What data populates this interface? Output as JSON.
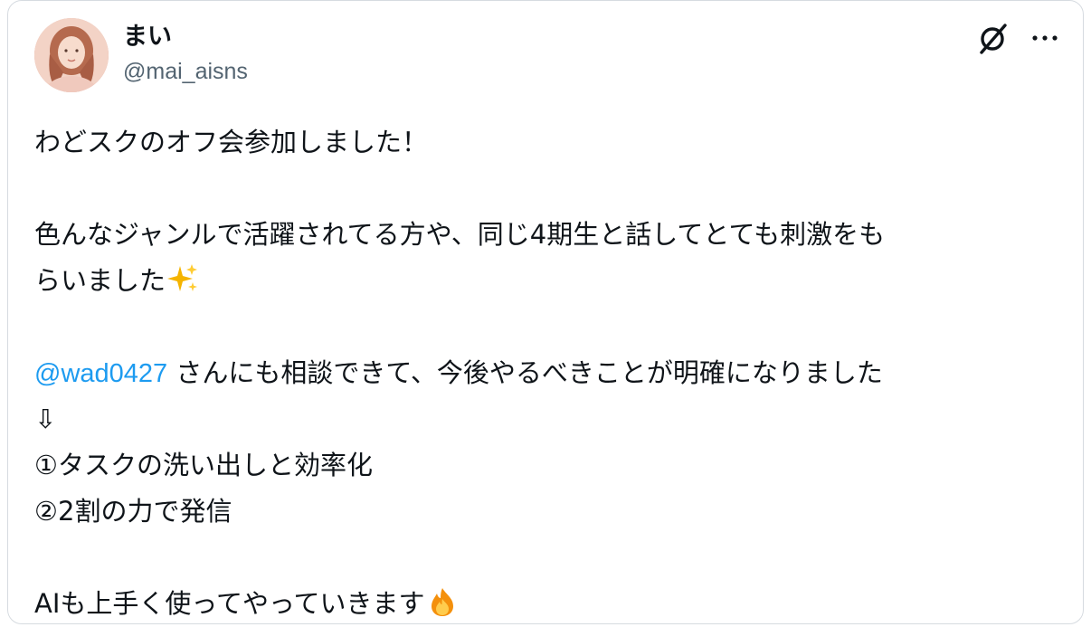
{
  "post": {
    "author": {
      "display_name": "まい",
      "handle": "@mai_aisns"
    },
    "header_icons": [
      "x-logo-icon",
      "more-options-icon"
    ],
    "body": {
      "line1": "わどスクのオフ会参加しました！",
      "line2": "色んなジャンルで活躍されてる方や、同じ4期生と話してとても刺激をも",
      "line3": "らいました",
      "line3_emoji": "sparkles-emoji",
      "mention": "@wad0427",
      "line4_rest": " さんにも相談できて、今後やるべきことが明確になりました",
      "arrow": "⇩",
      "item1": "①タスクの洗い出しと効率化",
      "item2": "②2割の力で発信",
      "line_last": "AIも上手く使ってやっていきます",
      "line_last_emoji": "fire-emoji"
    },
    "colors": {
      "text": "#0f1419",
      "secondary": "#536471",
      "mention": "#1d9bf0",
      "border": "#d6dbe0"
    }
  }
}
